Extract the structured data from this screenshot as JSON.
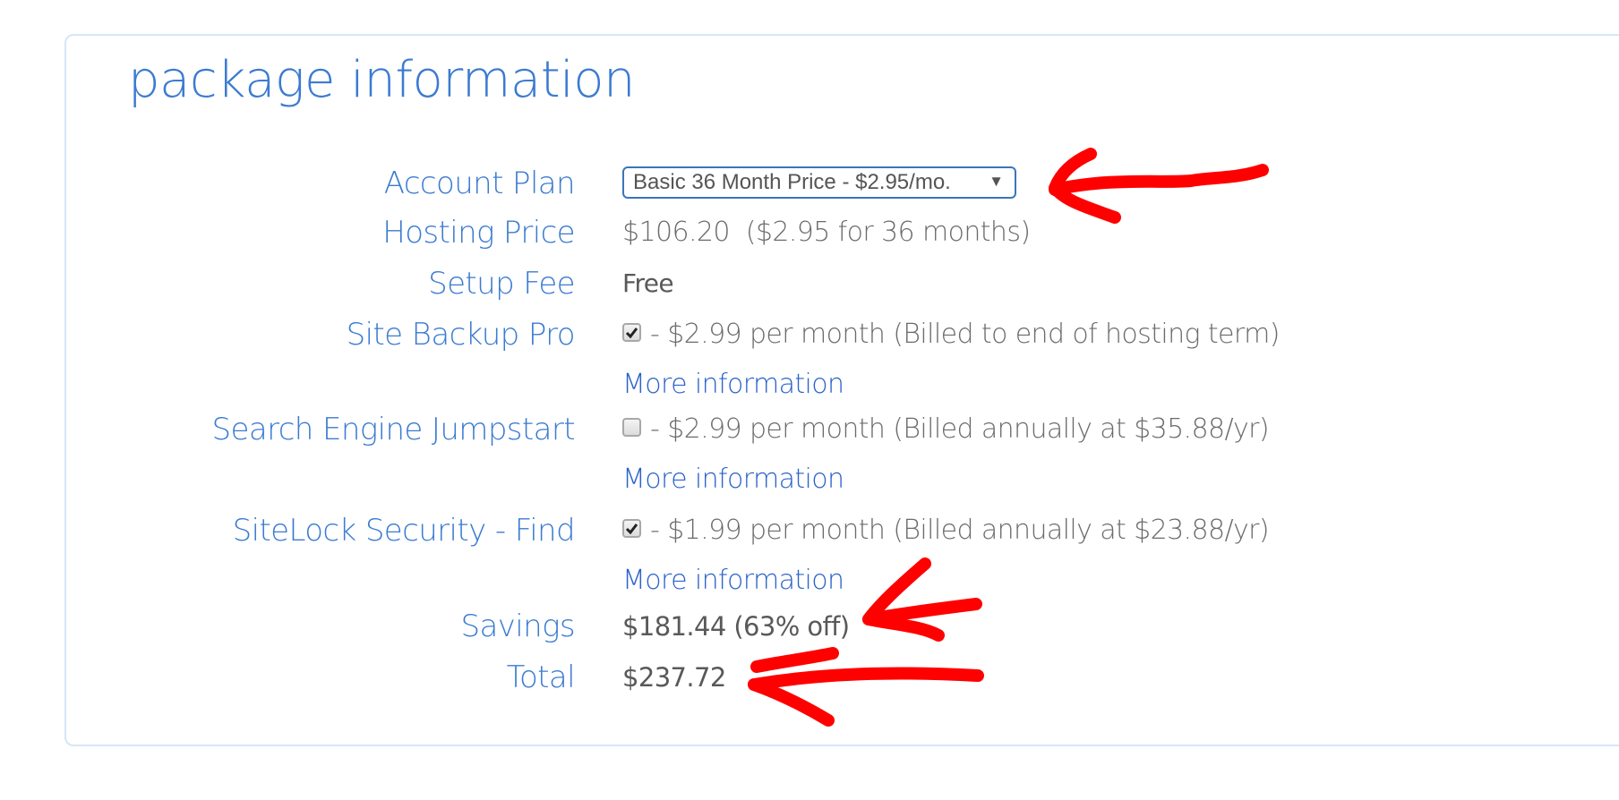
{
  "section": {
    "title": "package information"
  },
  "account_plan": {
    "label": "Account Plan",
    "selected": "Basic 36 Month Price - $2.95/mo."
  },
  "hosting_price": {
    "label": "Hosting Price",
    "value": "$106.20  ($2.95 for 36 months)"
  },
  "setup_fee": {
    "label": "Setup Fee",
    "value": "Free"
  },
  "addons": [
    {
      "label": "Site Backup Pro",
      "checked": true,
      "price_text": "- $2.99 per month (Billed to end of hosting term)",
      "more_link": "More information"
    },
    {
      "label": "Search Engine Jumpstart",
      "checked": false,
      "price_text": "- $2.99 per month (Billed annually at $35.88/yr)",
      "more_link": "More information"
    },
    {
      "label": "SiteLock Security - Find",
      "checked": true,
      "price_text": "- $1.99 per month (Billed annually at $23.88/yr)",
      "more_link": "More information"
    }
  ],
  "savings": {
    "label": "Savings",
    "value": "$181.44 (63% off)"
  },
  "total": {
    "label": "Total",
    "value": "$237.72"
  },
  "icons": {
    "dropdown": "triangle-down",
    "checkbox_checked": "check-mark",
    "annotation": "red-hand-drawn-arrow"
  },
  "colors": {
    "label_blue": "#3b7bd1",
    "link_blue": "#2b62c9",
    "value_gray": "#6b6b6b",
    "panel_border": "#d6e6f7",
    "annotation_red": "#ff0000"
  }
}
